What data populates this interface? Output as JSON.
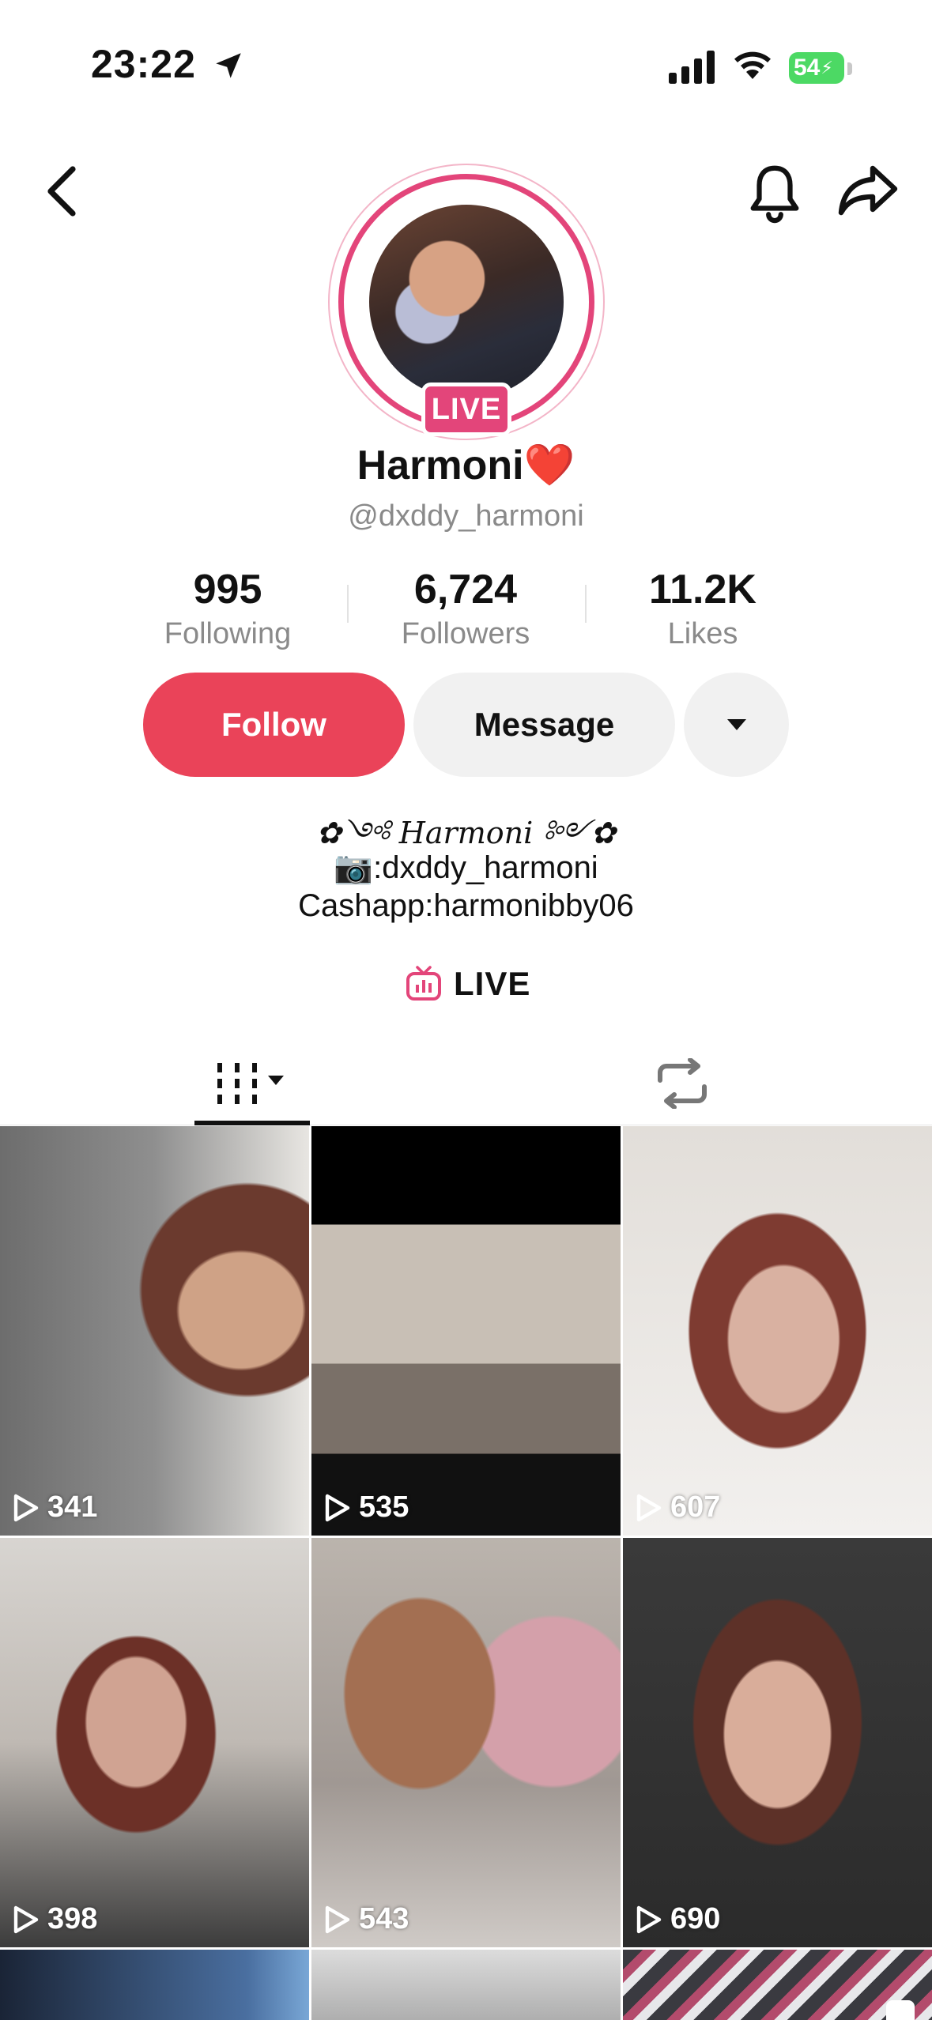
{
  "status_bar": {
    "time": "23:22",
    "battery": "54",
    "icons": [
      "location-arrow-icon",
      "cellular-signal-icon",
      "wifi-icon",
      "battery-charging-icon"
    ]
  },
  "nav": {
    "icons": [
      "chevron-left-icon",
      "bell-icon",
      "share-arrow-icon"
    ]
  },
  "profile": {
    "live_badge": "LIVE",
    "display_name": "Harmoni❤️",
    "username": "@dxddy_harmoni"
  },
  "stats": [
    {
      "value": "995",
      "label": "Following"
    },
    {
      "value": "6,724",
      "label": "Followers"
    },
    {
      "value": "11.2K",
      "label": "Likes"
    }
  ],
  "actions": {
    "follow": "Follow",
    "message": "Message"
  },
  "bio": {
    "line1": "✿༺ Harmoni ༻✿",
    "line2": "📷:dxddy_harmoni",
    "line3": "Cashapp:harmonibby06"
  },
  "live_link": "LIVE",
  "tabs": [
    "videos-grid-icon",
    "repost-icon"
  ],
  "videos": [
    {
      "views": "341"
    },
    {
      "views": "535"
    },
    {
      "views": "607"
    },
    {
      "views": "398"
    },
    {
      "views": "543"
    },
    {
      "views": "690"
    }
  ],
  "colors": {
    "accent_red": "#ea4359",
    "live_pink": "#e3457a",
    "battery_green": "#4cd964"
  }
}
